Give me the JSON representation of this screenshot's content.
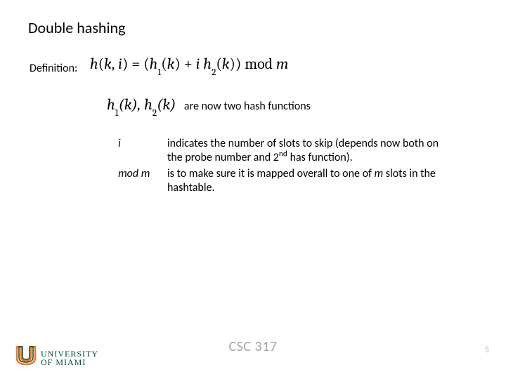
{
  "title": "Double hashing",
  "definition_label": "Definition:",
  "formula_html": "h<span class='upright'>(</span>k<span class='upright'>,</span> i<span class='upright'>)</span> <span class='upright'>=</span> <span class='upright'>(</span>h<sub>1</sub><span class='upright'>(</span>k<span class='upright'>)</span> <span class='upright'>+</span> i h<sub>2</sub><span class='upright'>(</span>k<span class='upright'>))</span> <span class='upright'>mod</span> m",
  "hash_funcs_html": "h<sub>1</sub><span class='upright'>(</span>k<span class='upright'>),</span> h<sub>2</sub><span class='upright'>(</span>k<span class='upright'>)</span>",
  "hash_funcs_desc": "are now two hash functions",
  "terms": {
    "i": {
      "label": "i",
      "desc_html": "indicates the number of slots to skip (depends now both on the probe number and 2<sup class='nd'>nd</sup> has function)."
    },
    "modm": {
      "label": "mod m",
      "desc_html": "is to make sure it is mapped overall to one of <span class='ital'>m</span> slots in the hashtable."
    }
  },
  "footer": {
    "course": "CSC 317",
    "page": "5"
  },
  "logo": {
    "line1": "UNIVERSITY",
    "line2": "OF MIAMI",
    "alt": "university-of-miami-logo"
  },
  "colors": {
    "footer_gray": "#a5a5a5",
    "page_gray": "#bfbfbf",
    "miami_green": "#005030",
    "miami_orange": "#f47321"
  }
}
